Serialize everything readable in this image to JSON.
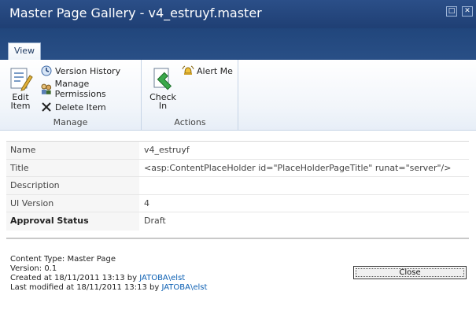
{
  "window": {
    "title": "Master Page Gallery - v4_estruyf.master",
    "maximize_glyph": "□",
    "close_glyph": "✕"
  },
  "tabs": [
    {
      "label": "View"
    }
  ],
  "ribbon": {
    "manage": {
      "label": "Manage",
      "edit_item": {
        "label_line1": "Edit",
        "label_line2": "Item",
        "icon": "edit-item-icon"
      },
      "version_history": {
        "label": "Version History",
        "icon": "version-history-icon"
      },
      "manage_permissions": {
        "label": "Manage Permissions",
        "icon": "permissions-icon"
      },
      "delete_item": {
        "label": "Delete Item",
        "icon": "delete-x-icon"
      }
    },
    "actions": {
      "label": "Actions",
      "check_in": {
        "label_line1": "Check",
        "label_line2": "In",
        "icon": "check-in-icon"
      },
      "alert_me": {
        "label": "Alert Me",
        "icon": "alert-bell-icon"
      }
    }
  },
  "details": {
    "rows": [
      {
        "label": "Name",
        "value": "v4_estruyf"
      },
      {
        "label": "Title",
        "value": "<asp:ContentPlaceHolder id=\"PlaceHolderPageTitle\" runat=\"server\"/>"
      },
      {
        "label": "Description",
        "value": ""
      },
      {
        "label": "UI Version",
        "value": "4"
      },
      {
        "label": "Approval Status",
        "value": "Draft"
      }
    ]
  },
  "footer": {
    "content_type": "Content Type: Master Page",
    "version": "Version: 0.1",
    "created_prefix": "Created at 18/11/2011 13:13 by ",
    "created_by": "JATOBA\\elst",
    "modified_prefix": "Last modified at 18/11/2011 13:13 by ",
    "modified_by": "JATOBA\\elst"
  },
  "close_button": {
    "label": "Close"
  },
  "colors": {
    "titlebar": "#1f3f74",
    "link": "#0b5fb3"
  }
}
